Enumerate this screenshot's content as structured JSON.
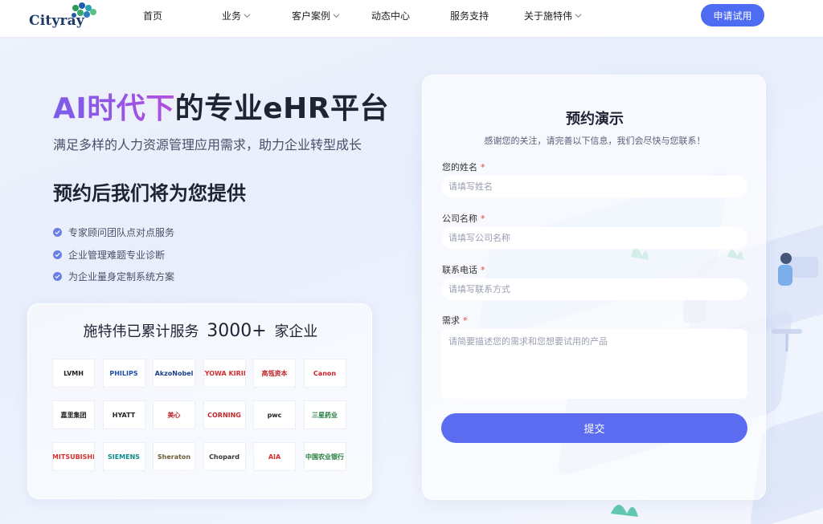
{
  "header": {
    "logo_text": "Cityray",
    "nav": [
      {
        "label": "首页",
        "has_dropdown": false
      },
      {
        "label": "业务",
        "has_dropdown": true
      },
      {
        "label": "客户案例",
        "has_dropdown": true
      },
      {
        "label": "动态中心",
        "has_dropdown": false
      },
      {
        "label": "服务支持",
        "has_dropdown": false
      },
      {
        "label": "关于施特伟",
        "has_dropdown": true
      }
    ],
    "cta_label": "申请试用"
  },
  "hero": {
    "title_highlight": "AI时代下",
    "title_rest": "的专业eHR平台",
    "subtitle": "满足多样的人力资源管理应用需求，助力企业转型成长",
    "offer_heading": "预约后我们将为您提供",
    "bullets": [
      "专家顾问团队点对点服务",
      "企业管理难题专业诊断",
      "为企业量身定制系统方案"
    ]
  },
  "clients": {
    "prefix": "施特伟已累计服务",
    "count": "3000+",
    "suffix": "家企业",
    "logos": [
      {
        "name": "LVMH",
        "color": "#222222"
      },
      {
        "name": "PHILIPS",
        "color": "#1f4fa8"
      },
      {
        "name": "AkzoNobel",
        "color": "#1b3f8a"
      },
      {
        "name": "KYOWA KIRIN",
        "color": "#d62f2f"
      },
      {
        "name": "高瓴资本",
        "color": "#c0272d"
      },
      {
        "name": "Canon",
        "color": "#cc1f26"
      },
      {
        "name": "嘉里集团",
        "color": "#222222"
      },
      {
        "name": "HYATT",
        "color": "#222222"
      },
      {
        "name": "美心",
        "color": "#c0272d"
      },
      {
        "name": "CORNING",
        "color": "#c0272d"
      },
      {
        "name": "pwc",
        "color": "#222222"
      },
      {
        "name": "三星药业",
        "color": "#1f7a3a"
      },
      {
        "name": "MITSUBISHI",
        "color": "#d62f2f"
      },
      {
        "name": "SIEMENS",
        "color": "#0f8a8a"
      },
      {
        "name": "Sheraton",
        "color": "#6b5a36"
      },
      {
        "name": "Chopard",
        "color": "#333333"
      },
      {
        "name": "AIA",
        "color": "#d62f2f"
      },
      {
        "name": "中国农业银行",
        "color": "#1f7a3a"
      }
    ]
  },
  "form": {
    "title": "预约演示",
    "desc": "感谢您的关注，请完善以下信息，我们会尽快与您联系！",
    "name_label": "您的姓名",
    "name_placeholder": "请填写姓名",
    "company_label": "公司名称",
    "company_placeholder": "请填写公司名称",
    "phone_label": "联系电话",
    "phone_placeholder": "请填写联系方式",
    "need_label": "需求",
    "need_placeholder": "请简要描述您的需求和您想要试用的产品",
    "required_mark": "*",
    "submit_label": "提交"
  },
  "colors": {
    "accent": "#4e6cf2",
    "submit": "#5b6cf0",
    "required": "#e0443f"
  }
}
